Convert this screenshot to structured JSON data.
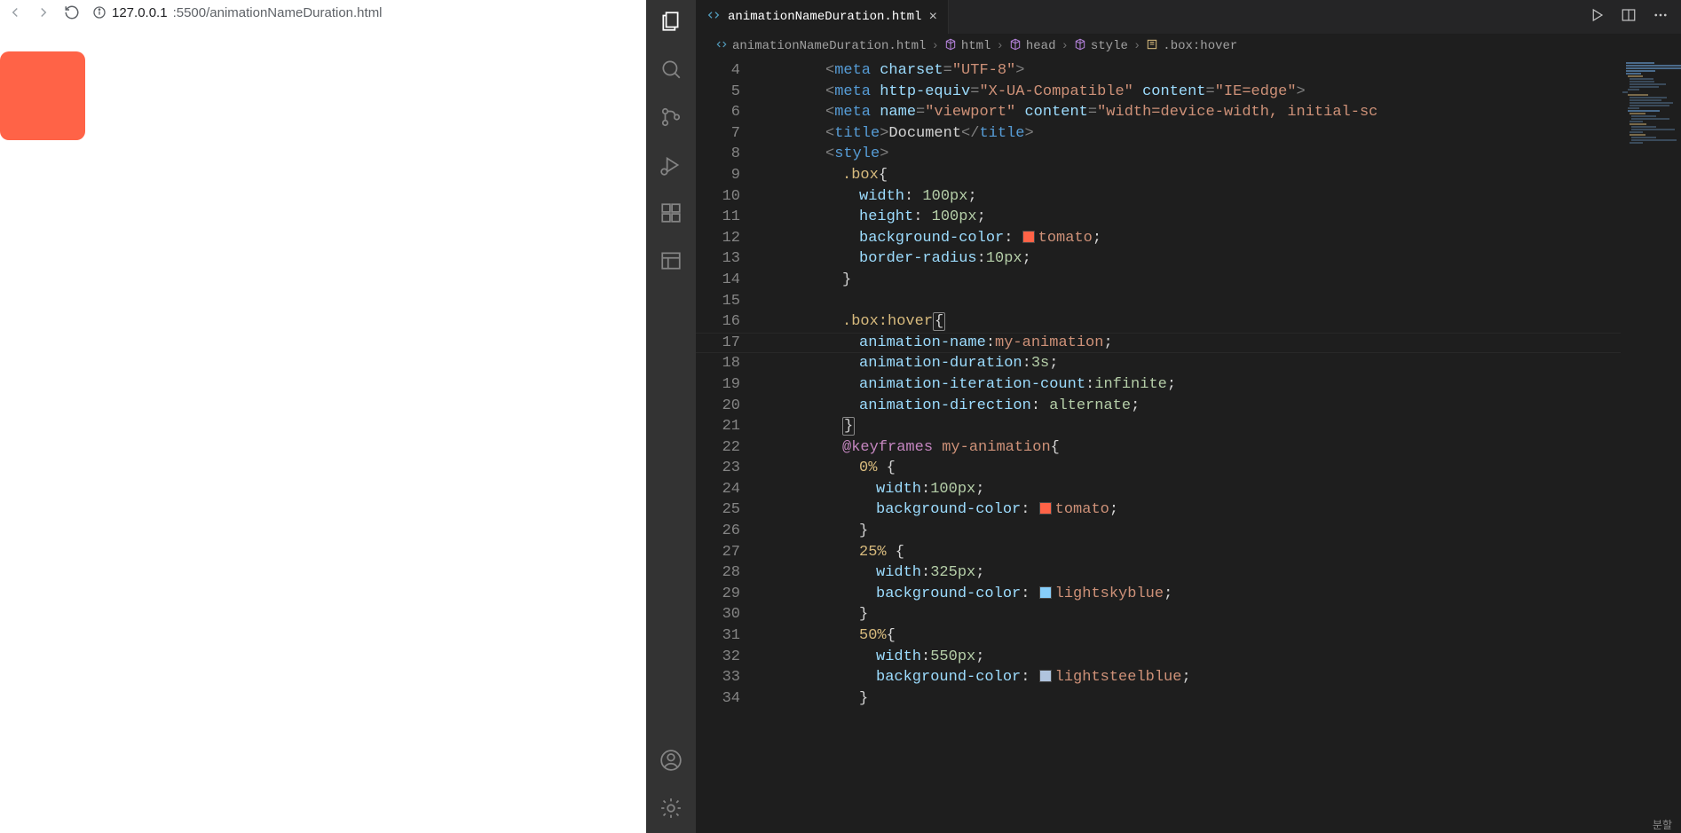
{
  "browser": {
    "url_host": "127.0.0.1",
    "url_port_path": ":5500/animationNameDuration.html"
  },
  "vscode": {
    "tab": {
      "filename": "animationNameDuration.html"
    },
    "breadcrumbs": [
      {
        "icon": "file",
        "label": "animationNameDuration.html"
      },
      {
        "icon": "cube",
        "label": "html"
      },
      {
        "icon": "cube",
        "label": "head"
      },
      {
        "icon": "cube",
        "label": "style"
      },
      {
        "icon": "sel",
        "label": ".box:hover"
      }
    ],
    "line_start": 4,
    "highlight_line": 17,
    "code_lines": [
      {
        "n": 4,
        "indent": 2,
        "tokens": [
          [
            "<",
            "punc"
          ],
          [
            "meta",
            "tag"
          ],
          [
            " ",
            "text"
          ],
          [
            "charset",
            "attr"
          ],
          [
            "=",
            "punc"
          ],
          [
            "\"UTF-8\"",
            "str"
          ],
          [
            ">",
            "punc"
          ]
        ]
      },
      {
        "n": 5,
        "indent": 2,
        "tokens": [
          [
            "<",
            "punc"
          ],
          [
            "meta",
            "tag"
          ],
          [
            " ",
            "text"
          ],
          [
            "http-equiv",
            "attr"
          ],
          [
            "=",
            "punc"
          ],
          [
            "\"X-UA-Compatible\"",
            "str"
          ],
          [
            " ",
            "text"
          ],
          [
            "content",
            "attr"
          ],
          [
            "=",
            "punc"
          ],
          [
            "\"IE=edge\"",
            "str"
          ],
          [
            ">",
            "punc"
          ]
        ]
      },
      {
        "n": 6,
        "indent": 2,
        "tokens": [
          [
            "<",
            "punc"
          ],
          [
            "meta",
            "tag"
          ],
          [
            " ",
            "text"
          ],
          [
            "name",
            "attr"
          ],
          [
            "=",
            "punc"
          ],
          [
            "\"viewport\"",
            "str"
          ],
          [
            " ",
            "text"
          ],
          [
            "content",
            "attr"
          ],
          [
            "=",
            "punc"
          ],
          [
            "\"width=device-width, initial-sc",
            "str"
          ]
        ]
      },
      {
        "n": 7,
        "indent": 2,
        "tokens": [
          [
            "<",
            "punc"
          ],
          [
            "title",
            "tag"
          ],
          [
            ">",
            "punc"
          ],
          [
            "Document",
            "text"
          ],
          [
            "</",
            "punc"
          ],
          [
            "title",
            "tag"
          ],
          [
            ">",
            "punc"
          ]
        ]
      },
      {
        "n": 8,
        "indent": 2,
        "tokens": [
          [
            "<",
            "punc"
          ],
          [
            "style",
            "tag"
          ],
          [
            ">",
            "punc"
          ]
        ]
      },
      {
        "n": 9,
        "indent": 3,
        "tokens": [
          [
            ".box",
            "sel"
          ],
          [
            "{",
            "brace"
          ]
        ]
      },
      {
        "n": 10,
        "indent": 4,
        "tokens": [
          [
            "width",
            "prop"
          ],
          [
            ": ",
            "text"
          ],
          [
            "100px",
            "num"
          ],
          [
            ";",
            "text"
          ]
        ]
      },
      {
        "n": 11,
        "indent": 4,
        "tokens": [
          [
            "height",
            "prop"
          ],
          [
            ": ",
            "text"
          ],
          [
            "100px",
            "num"
          ],
          [
            ";",
            "text"
          ]
        ]
      },
      {
        "n": 12,
        "indent": 4,
        "tokens": [
          [
            "background-color",
            "prop"
          ],
          [
            ": ",
            "text"
          ],
          [
            "SWATCH:tomato",
            ""
          ],
          [
            "tomato",
            "val"
          ],
          [
            ";",
            "text"
          ]
        ]
      },
      {
        "n": 13,
        "indent": 4,
        "tokens": [
          [
            "border-radius",
            "prop"
          ],
          [
            ":",
            "text"
          ],
          [
            "10px",
            "num"
          ],
          [
            ";",
            "text"
          ]
        ]
      },
      {
        "n": 14,
        "indent": 3,
        "tokens": [
          [
            "}",
            "brace"
          ]
        ]
      },
      {
        "n": 15,
        "indent": 0,
        "tokens": []
      },
      {
        "n": 16,
        "indent": 3,
        "tokens": [
          [
            ".box:hover",
            "sel"
          ],
          [
            "{",
            "brace-match"
          ]
        ]
      },
      {
        "n": 17,
        "indent": 4,
        "tokens": [
          [
            "animation-name",
            "prop"
          ],
          [
            ":",
            "text"
          ],
          [
            "my-animation",
            "val"
          ],
          [
            ";",
            "text"
          ]
        ]
      },
      {
        "n": 18,
        "indent": 4,
        "tokens": [
          [
            "animation-duration",
            "prop"
          ],
          [
            ":",
            "text"
          ],
          [
            "3s",
            "num"
          ],
          [
            ";",
            "text"
          ]
        ]
      },
      {
        "n": 19,
        "indent": 4,
        "tokens": [
          [
            "animation-iteration-count",
            "prop"
          ],
          [
            ":",
            "text"
          ],
          [
            "infinite",
            "num"
          ],
          [
            ";",
            "text"
          ]
        ]
      },
      {
        "n": 20,
        "indent": 4,
        "tokens": [
          [
            "animation-direction",
            "prop"
          ],
          [
            ": ",
            "text"
          ],
          [
            "alternate",
            "num"
          ],
          [
            ";",
            "text"
          ]
        ]
      },
      {
        "n": 21,
        "indent": 3,
        "tokens": [
          [
            "}",
            "brace-match"
          ]
        ]
      },
      {
        "n": 22,
        "indent": 3,
        "tokens": [
          [
            "@keyframes",
            "key"
          ],
          [
            " ",
            "text"
          ],
          [
            "my-animation",
            "val"
          ],
          [
            "{",
            "brace"
          ]
        ]
      },
      {
        "n": 23,
        "indent": 4,
        "tokens": [
          [
            "0%",
            "sel"
          ],
          [
            " {",
            "brace"
          ]
        ]
      },
      {
        "n": 24,
        "indent": 5,
        "tokens": [
          [
            "width",
            "prop"
          ],
          [
            ":",
            "text"
          ],
          [
            "100px",
            "num"
          ],
          [
            ";",
            "text"
          ]
        ]
      },
      {
        "n": 25,
        "indent": 5,
        "tokens": [
          [
            "background-color",
            "prop"
          ],
          [
            ": ",
            "text"
          ],
          [
            "SWATCH:tomato",
            ""
          ],
          [
            "tomato",
            "val"
          ],
          [
            ";",
            "text"
          ]
        ]
      },
      {
        "n": 26,
        "indent": 4,
        "tokens": [
          [
            "}",
            "brace"
          ]
        ]
      },
      {
        "n": 27,
        "indent": 4,
        "tokens": [
          [
            "25%",
            "sel"
          ],
          [
            " {",
            "brace"
          ]
        ]
      },
      {
        "n": 28,
        "indent": 5,
        "tokens": [
          [
            "width",
            "prop"
          ],
          [
            ":",
            "text"
          ],
          [
            "325px",
            "num"
          ],
          [
            ";",
            "text"
          ]
        ]
      },
      {
        "n": 29,
        "indent": 5,
        "tokens": [
          [
            "background-color",
            "prop"
          ],
          [
            ": ",
            "text"
          ],
          [
            "SWATCH:lightskyblue",
            ""
          ],
          [
            "lightskyblue",
            "val"
          ],
          [
            ";",
            "text"
          ]
        ]
      },
      {
        "n": 30,
        "indent": 4,
        "tokens": [
          [
            "}",
            "brace"
          ]
        ]
      },
      {
        "n": 31,
        "indent": 4,
        "tokens": [
          [
            "50%",
            "sel"
          ],
          [
            "{",
            "brace"
          ]
        ]
      },
      {
        "n": 32,
        "indent": 5,
        "tokens": [
          [
            "width",
            "prop"
          ],
          [
            ":",
            "text"
          ],
          [
            "550px",
            "num"
          ],
          [
            ";",
            "text"
          ]
        ]
      },
      {
        "n": 33,
        "indent": 5,
        "tokens": [
          [
            "background-color",
            "prop"
          ],
          [
            ": ",
            "text"
          ],
          [
            "SWATCH:lightsteelblue",
            ""
          ],
          [
            "lightsteelblue",
            "val"
          ],
          [
            ";",
            "text"
          ]
        ]
      },
      {
        "n": 34,
        "indent": 4,
        "tokens": [
          [
            "}",
            "brace"
          ]
        ]
      }
    ],
    "status_right": "분할"
  }
}
